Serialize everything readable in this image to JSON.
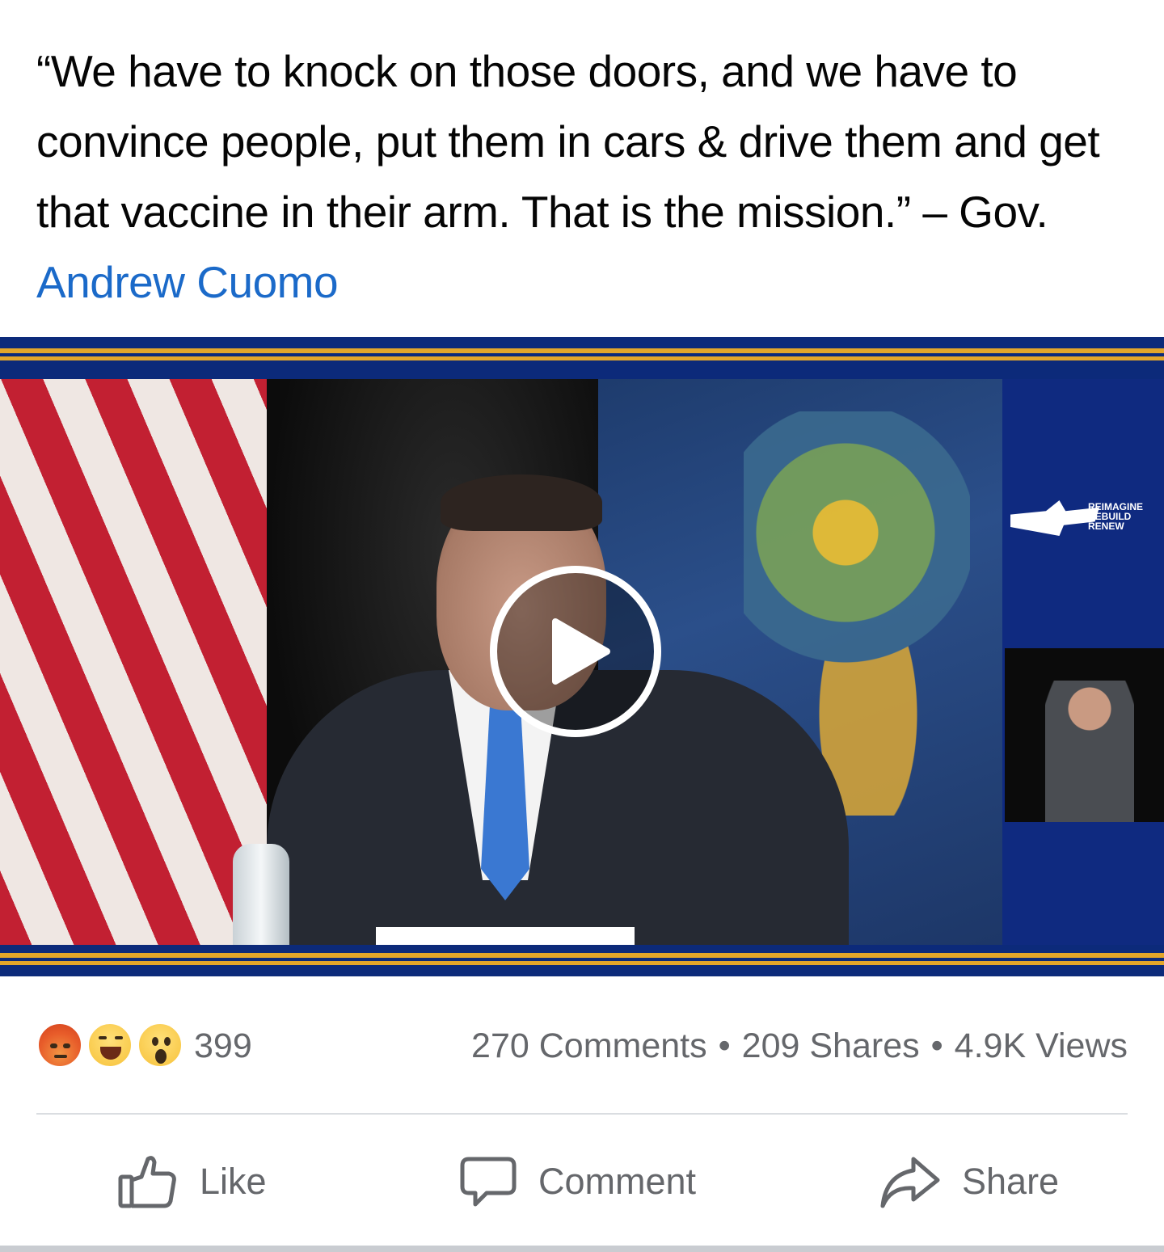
{
  "post": {
    "text": "“We have to knock on those doors, and we have to convince people, put them in cars & drive them and get that vaccine in their arm. That is the mission.” – Gov. ",
    "mention": "Andrew Cuomo"
  },
  "video": {
    "play_icon": "play-icon",
    "overlay_logo": [
      "REIMAGINE",
      "REBUILD",
      "RENEW"
    ],
    "colors": {
      "frame_blue": "#0c2a7a",
      "stripe_gold": "#e3a62a"
    }
  },
  "stats": {
    "reactions": [
      "angry",
      "haha",
      "wow"
    ],
    "reaction_count": "399",
    "comments": "270 Comments",
    "shares": "209 Shares",
    "views": "4.9K Views",
    "separator": "•"
  },
  "actions": {
    "like": "Like",
    "comment": "Comment",
    "share": "Share"
  }
}
